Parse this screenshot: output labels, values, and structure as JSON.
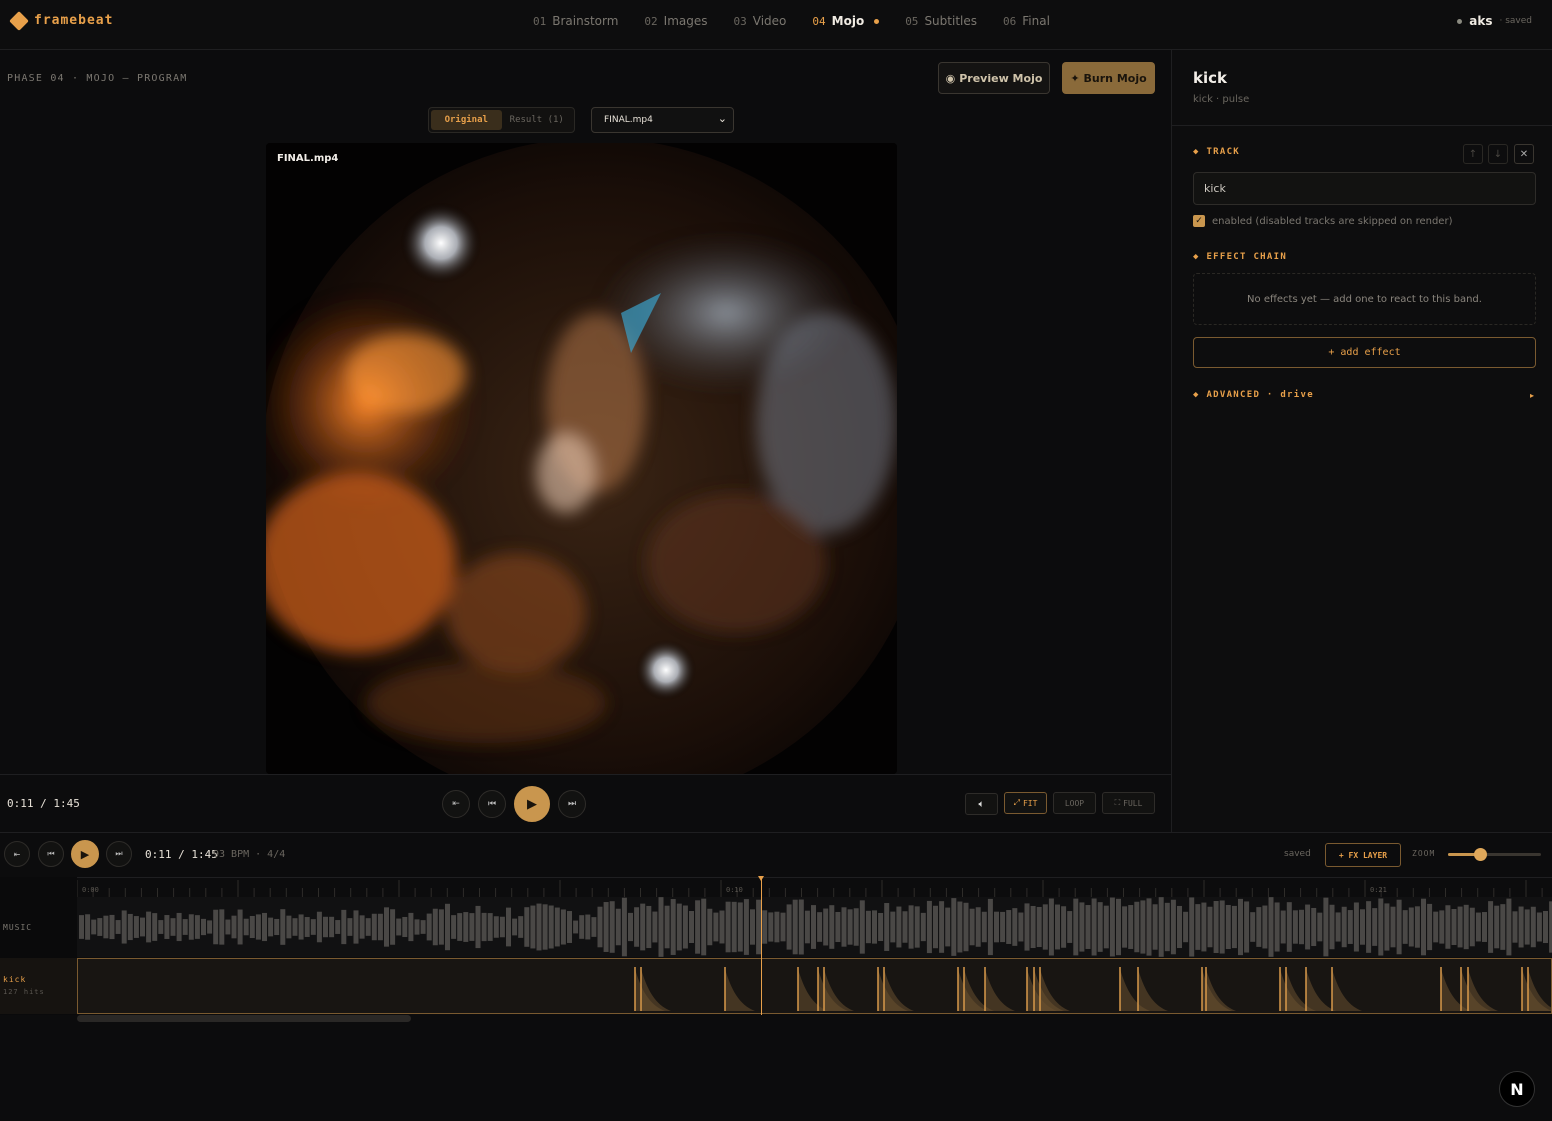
{
  "brand": {
    "name": "framebeat",
    "accent": "#e8a04a"
  },
  "phases": [
    {
      "num": "01",
      "label": "Brainstorm",
      "active": false
    },
    {
      "num": "02",
      "label": "Images",
      "active": false
    },
    {
      "num": "03",
      "label": "Video",
      "active": false
    },
    {
      "num": "04",
      "label": "Mojo",
      "active": true
    },
    {
      "num": "05",
      "label": "Subtitles",
      "active": false
    },
    {
      "num": "06",
      "label": "Final",
      "active": false
    }
  ],
  "user": {
    "name": "aks",
    "status": "· saved"
  },
  "main": {
    "phase_label": "PHASE 04 · MOJO — PROGRAM",
    "preview_button": "Preview Mojo",
    "burn_button": "Burn Mojo",
    "toggle": {
      "original": "Original",
      "result": "Result (1)"
    },
    "file_select": "FINAL.mp4",
    "video_label": "FINAL.mp4",
    "time": "0:11 / 1:45",
    "fit": "FIT",
    "loop": "LOOP",
    "full": "FULL"
  },
  "panel": {
    "title": "kick",
    "subtitle": "kick · pulse",
    "track_section": "TRACK",
    "track_value": "kick",
    "enabled_text": "enabled (disabled tracks are skipped on render)",
    "enabled": true,
    "effect_section": "EFFECT CHAIN",
    "empty_text": "No effects yet — add one to react to this band.",
    "add_effect": "+ add effect",
    "advanced_section": "ADVANCED · drive"
  },
  "timeline": {
    "time": "0:11 / 1:45",
    "bpm": "93 BPM · 4/4",
    "saved": "saved",
    "fx_layer": "+ FX LAYER",
    "zoom_label": "ZOOM",
    "zoom_level": 0.34,
    "ruler": [
      "0:00",
      "0:10",
      "0:21"
    ],
    "music_label": "MUSIC",
    "kick_label": "kick",
    "kick_hits": "127 hits"
  },
  "icons": {
    "preview": "eye-icon",
    "burn": "sparkle-icon",
    "play": "play-icon",
    "close": "close-icon",
    "volume": "volume-icon",
    "badge": "N"
  }
}
